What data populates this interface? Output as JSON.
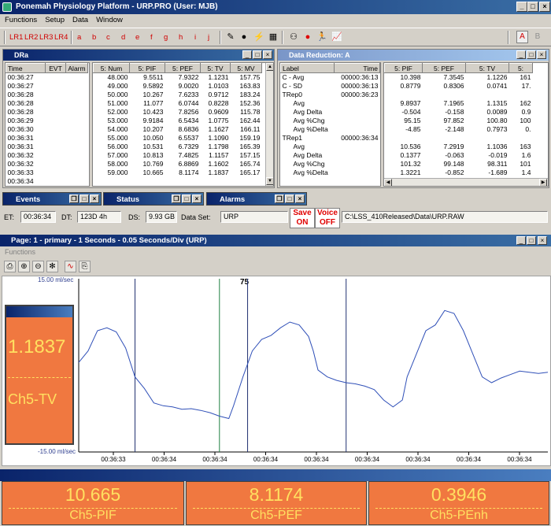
{
  "app": {
    "title": "Ponemah Physiology Platform  - URP.PRO (User: MJB)"
  },
  "menu": [
    "Functions",
    "Setup",
    "Data",
    "Window"
  ],
  "toolbar": {
    "lr_buttons": [
      "LR1",
      "LR2",
      "LR3",
      "LR4"
    ],
    "letters": [
      "a",
      "b",
      "c",
      "d",
      "e",
      "f",
      "g",
      "h",
      "i",
      "j"
    ],
    "right_letters": [
      "A",
      "B"
    ]
  },
  "dra": {
    "title": "DRa",
    "left_headers": [
      "Time",
      "EVT",
      "Alarm"
    ],
    "times": [
      "00:36:27",
      "00:36:27",
      "00:36:28",
      "00:36:28",
      "00:36:28",
      "00:36:29",
      "00:36:30",
      "00:36:31",
      "00:36:31",
      "00:36:32",
      "00:36:32",
      "00:36:33",
      "00:36:34"
    ],
    "right_headers": [
      "5:  Num",
      "5:  PIF",
      "5:  PEF",
      "5:  TV",
      "5:  MV"
    ],
    "rows": [
      [
        "48.000",
        "9.5511",
        "7.9322",
        "1.1231",
        "157.75"
      ],
      [
        "49.000",
        "9.5892",
        "9.0020",
        "1.0103",
        "163.83"
      ],
      [
        "50.000",
        "10.267",
        "7.6233",
        "0.9712",
        "183.24"
      ],
      [
        "51.000",
        "11.077",
        "6.0744",
        "0.8228",
        "152.36"
      ],
      [
        "52.000",
        "10.423",
        "7.8256",
        "0.9609",
        "115.78"
      ],
      [
        "53.000",
        "9.9184",
        "6.5434",
        "1.0775",
        "162.44"
      ],
      [
        "54.000",
        "10.207",
        "8.6836",
        "1.1627",
        "166.11"
      ],
      [
        "55.000",
        "10.050",
        "6.5537",
        "1.1090",
        "159.19"
      ],
      [
        "56.000",
        "10.531",
        "6.7329",
        "1.1798",
        "165.39"
      ],
      [
        "57.000",
        "10.813",
        "7.4825",
        "1.1157",
        "157.15"
      ],
      [
        "58.000",
        "10.769",
        "6.8869",
        "1.1602",
        "165.74"
      ],
      [
        "59.000",
        "10.665",
        "8.1174",
        "1.1837",
        "165.17"
      ]
    ]
  },
  "data_reduction": {
    "title": "Data Reduction: A",
    "left_headers": [
      "Label",
      "Time"
    ],
    "labels": [
      [
        "C - Avg",
        "00000:36:13"
      ],
      [
        "C - SD",
        "00000:36:13"
      ],
      [
        "TRep0",
        "00000:36:23"
      ],
      [
        "Avg",
        ""
      ],
      [
        "Avg Delta",
        ""
      ],
      [
        "Avg %Chg",
        ""
      ],
      [
        "Avg %Delta",
        ""
      ],
      [
        "TRep1",
        "00000:36:34"
      ],
      [
        "Avg",
        ""
      ],
      [
        "Avg Delta",
        ""
      ],
      [
        "Avg %Chg",
        ""
      ],
      [
        "Avg %Delta",
        ""
      ]
    ],
    "right_headers": [
      "5:  PIF",
      "5:  PEF",
      "5:  TV",
      "5:"
    ],
    "rows": [
      [
        "10.398",
        "7.3545",
        "1.1226",
        "161"
      ],
      [
        "0.8779",
        "0.8306",
        "0.0741",
        "17."
      ],
      [
        "",
        "",
        "",
        ""
      ],
      [
        "9.8937",
        "7.1965",
        "1.1315",
        "162"
      ],
      [
        "-0.504",
        "-0.158",
        "0.0089",
        "0.9"
      ],
      [
        "95.15",
        "97.852",
        "100.80",
        "100"
      ],
      [
        "-4.85",
        "-2.148",
        "0.7973",
        "0."
      ],
      [
        "",
        "",
        "",
        ""
      ],
      [
        "10.536",
        "7.2919",
        "1.1036",
        "163"
      ],
      [
        "0.1377",
        "-0.063",
        "-0.019",
        "1.6"
      ],
      [
        "101.32",
        "99.148",
        "98.311",
        "101"
      ],
      [
        "1.3221",
        "-0.852",
        "-1.689",
        "1.4"
      ]
    ]
  },
  "min_windows": [
    "Events",
    "Status",
    "Alarms"
  ],
  "status": {
    "et_label": "ET:",
    "et_value": "00:36:34",
    "dt_label": "DT:",
    "dt_value": "123D 4h",
    "ds_label": "DS:",
    "ds_value": "9.93 GB",
    "dataset_label": "Data Set:",
    "dataset_value": "URP",
    "save_label": "Save",
    "save_state": "ON",
    "voice_label": "Voice",
    "voice_state": "OFF",
    "path": "C:\\LSS_410Released\\Data\\URP.RAW"
  },
  "page": {
    "title": "Page: 1 - primary - 1 Seconds - 0.05 Seconds/Div (URP)",
    "menu": "Functions",
    "marker_label": "75",
    "y_max_label": "15.00 ml/sec",
    "y_min_label": "-15.00 ml/sec"
  },
  "value_box": {
    "value": "1.1837",
    "name": "Ch5-TV"
  },
  "bottom_panels": [
    {
      "value": "10.665",
      "name": "Ch5-PIF"
    },
    {
      "value": "8.1174",
      "name": "Ch5-PEF"
    },
    {
      "value": "0.3946",
      "name": "Ch5-PEnh"
    }
  ],
  "chart_data": {
    "type": "line",
    "ylim": [
      -15,
      15
    ],
    "x_ticks": [
      "00:36:33",
      "00:36:34",
      "00:36:34",
      "00:36:34",
      "00:36:34",
      "00:36:34",
      "00:36:34",
      "00:36:34",
      "00:36:34"
    ],
    "series": [
      {
        "color": "#3050b8",
        "points": [
          [
            0,
            0.5
          ],
          [
            0.02,
            2.5
          ],
          [
            0.04,
            6.0
          ],
          [
            0.06,
            6.5
          ],
          [
            0.08,
            5.8
          ],
          [
            0.1,
            3.0
          ],
          [
            0.12,
            -2.0
          ],
          [
            0.14,
            -4.0
          ],
          [
            0.16,
            -6.5
          ],
          [
            0.18,
            -7.0
          ],
          [
            0.2,
            -7.2
          ],
          [
            0.22,
            -7.6
          ],
          [
            0.24,
            -7.5
          ],
          [
            0.26,
            -7.8
          ],
          [
            0.28,
            -8.2
          ],
          [
            0.3,
            -8.8
          ],
          [
            0.32,
            -9.2
          ],
          [
            0.33,
            -7.0
          ],
          [
            0.35,
            -2.0
          ],
          [
            0.37,
            2.5
          ],
          [
            0.39,
            4.5
          ],
          [
            0.41,
            5.2
          ],
          [
            0.43,
            6.5
          ],
          [
            0.45,
            7.5
          ],
          [
            0.47,
            7.0
          ],
          [
            0.49,
            5.0
          ],
          [
            0.5,
            2.5
          ],
          [
            0.51,
            -0.8
          ],
          [
            0.53,
            -2.0
          ],
          [
            0.55,
            -2.6
          ],
          [
            0.57,
            -3.0
          ],
          [
            0.59,
            -3.2
          ],
          [
            0.61,
            -3.6
          ],
          [
            0.63,
            -4.2
          ],
          [
            0.65,
            -6.0
          ],
          [
            0.67,
            -7.2
          ],
          [
            0.69,
            -6.0
          ],
          [
            0.7,
            -2.0
          ],
          [
            0.72,
            2.0
          ],
          [
            0.74,
            6.0
          ],
          [
            0.76,
            7.0
          ],
          [
            0.78,
            9.5
          ],
          [
            0.8,
            9.0
          ],
          [
            0.82,
            6.0
          ],
          [
            0.84,
            2.0
          ],
          [
            0.86,
            -2.0
          ],
          [
            0.88,
            -3.0
          ],
          [
            0.9,
            -2.2
          ],
          [
            0.92,
            -1.6
          ],
          [
            0.94,
            -1.0
          ],
          [
            0.96,
            -1.2
          ],
          [
            0.98,
            -1.4
          ],
          [
            1.0,
            -1.2
          ]
        ]
      }
    ],
    "cursors": [
      {
        "x": 0.12,
        "color": "#203070"
      },
      {
        "x": 0.3,
        "color": "#208040"
      },
      {
        "x": 0.36,
        "color": "#203070"
      },
      {
        "x": 0.57,
        "color": "#203070"
      }
    ]
  }
}
